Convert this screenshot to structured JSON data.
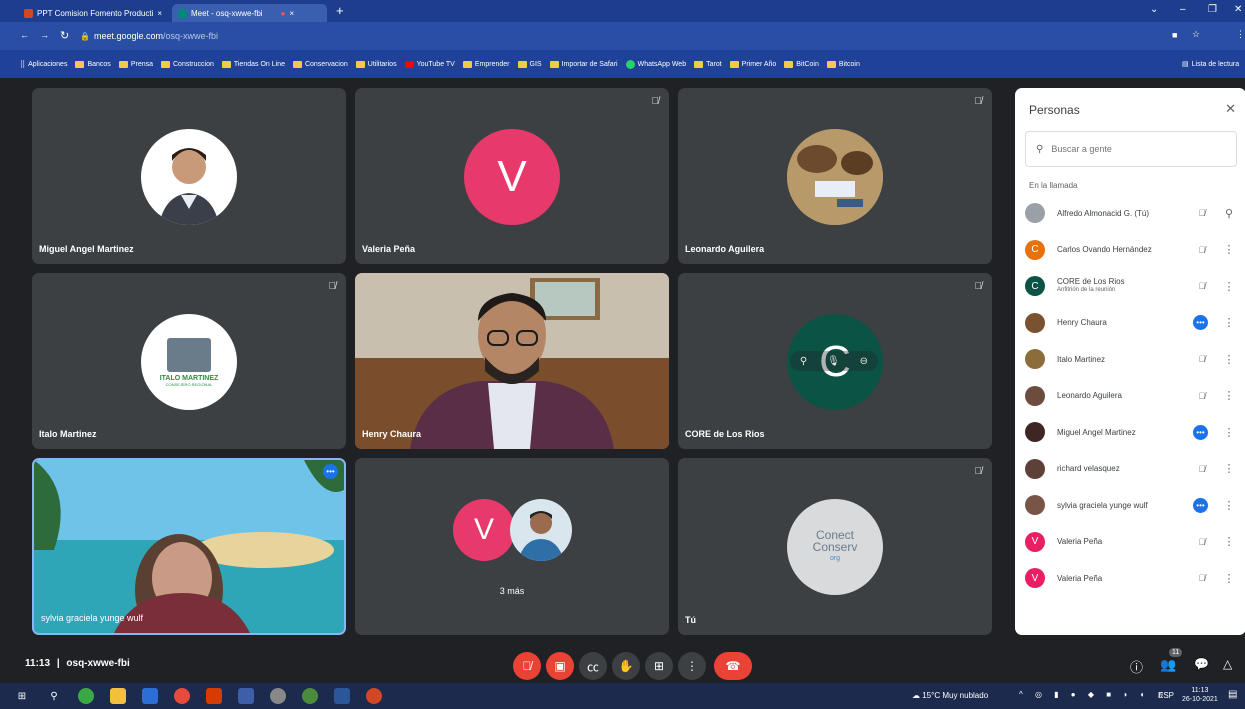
{
  "browser": {
    "tabs": [
      {
        "label": "PPT Comision Fomento Producti",
        "close": "×"
      },
      {
        "label": "Meet - osq-xwwe-fbi",
        "close": "×"
      }
    ],
    "new_tab": "+",
    "url_host": "meet.google.com",
    "url_path": "/osq-xwwe-fbi",
    "bookmarks": [
      "Aplicaciones",
      "Bancos",
      "Prensa",
      "Construccion",
      "Tiendas On Line",
      "Conservacion",
      "Utilitarios",
      "YouTube TV",
      "Emprender",
      "GIS",
      "Importar de Safari",
      "WhatsApp Web",
      "Tarot",
      "Primer Año",
      "BitCoin",
      "Bitcoin"
    ],
    "reading_list": "Lista de lectura"
  },
  "tiles": {
    "miguel": {
      "name": "Miguel Angel Martinez"
    },
    "valeria": {
      "name": "Valeria Peña",
      "initial": "V"
    },
    "leonardo": {
      "name": "Leonardo Aguilera"
    },
    "italo": {
      "name": "Italo Martinez",
      "logo_text": "ITALO MARTINEZ",
      "logo_sub": "CONSEJERO REGIONAL"
    },
    "henry": {
      "name": "Henry Chaura"
    },
    "core": {
      "name": "CORE de Los Rios",
      "initial": "C"
    },
    "sylvia": {
      "name": "sylvia graciela yunge wulf"
    },
    "more": {
      "label": "3 más",
      "initial": "V"
    },
    "tu": {
      "name": "Tú",
      "logo_line1": "Conect",
      "logo_line2": "Conserv",
      "logo_suffix": "org"
    }
  },
  "panel": {
    "title": "Personas",
    "search_placeholder": "Buscar a gente",
    "section": "En la llamada",
    "people": [
      {
        "name": "Alfredo Almonacid G. (Tú)",
        "sub": "",
        "initial": "",
        "color": "#9aa0a6"
      },
      {
        "name": "Carlos Ovando Hernández",
        "sub": "",
        "initial": "C",
        "color": "#e8710a"
      },
      {
        "name": "CORE de Los Rios",
        "sub": "Anfitrión de la reunión",
        "initial": "C",
        "color": "#0b5345"
      },
      {
        "name": "Henry Chaura",
        "sub": "",
        "initial": "",
        "color": "#7a5230"
      },
      {
        "name": "Italo Martinez",
        "sub": "",
        "initial": "",
        "color": "#8a6d3b"
      },
      {
        "name": "Leonardo Aguilera",
        "sub": "",
        "initial": "",
        "color": "#6d4c3d"
      },
      {
        "name": "Miguel Angel Martinez",
        "sub": "",
        "initial": "",
        "color": "#3e2723"
      },
      {
        "name": "richard velasquez",
        "sub": "",
        "initial": "",
        "color": "#5d4037"
      },
      {
        "name": "sylvia graciela yunge wulf",
        "sub": "",
        "initial": "",
        "color": "#795548"
      },
      {
        "name": "Valeria Peña",
        "sub": "",
        "initial": "V",
        "color": "#e91e63"
      },
      {
        "name": "Valeria Peña",
        "sub": "",
        "initial": "V",
        "color": "#e91e63"
      }
    ]
  },
  "meeting": {
    "time": "11:13",
    "separator": "|",
    "code": "osq-xwwe-fbi",
    "participant_count": "11"
  },
  "taskbar": {
    "weather": "15°C  Muy nublado",
    "lang": "ESP",
    "time": "11:13",
    "date": "26-10-2021"
  },
  "colors": {
    "end_call": "#ea4335",
    "muted_btn": "#ea4335",
    "accent": "#1a73e8"
  }
}
